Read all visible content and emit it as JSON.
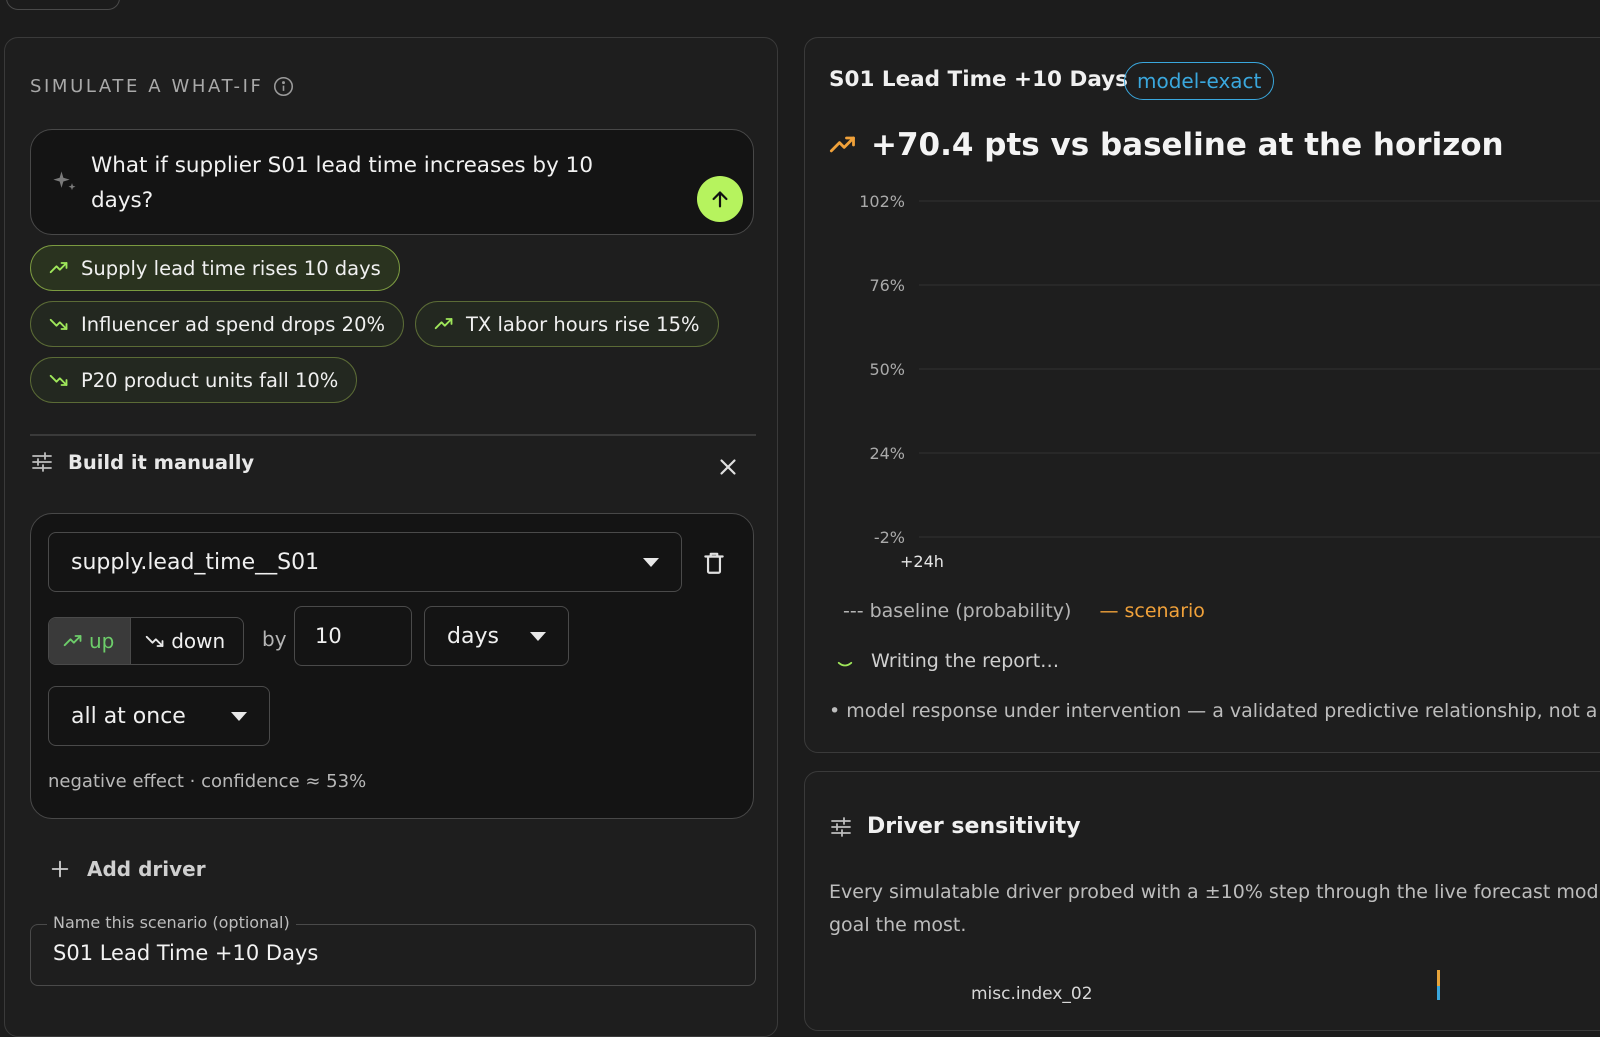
{
  "simulate": {
    "header": "SIMULATE A WHAT-IF",
    "prompt": "What if supplier S01 lead time increases by 10 days?",
    "suggestions": [
      {
        "label": "Supply lead time rises 10 days",
        "trend": "up",
        "active": true
      },
      {
        "label": "Influencer ad spend drops 20%",
        "trend": "down",
        "active": false
      },
      {
        "label": "TX labor hours rise 15%",
        "trend": "up",
        "active": false
      },
      {
        "label": "P20 product units fall 10%",
        "trend": "down",
        "active": false
      }
    ]
  },
  "manual": {
    "title": "Build it manually",
    "driver": "supply.lead_time__S01",
    "direction_up": "up",
    "direction_down": "down",
    "selected_direction": "up",
    "by_label": "by",
    "amount": "10",
    "unit": "days",
    "timing": "all at once",
    "effect": "negative effect · confidence ≈ 53%",
    "add_driver": "Add driver",
    "name_label": "Name this scenario (optional)",
    "name_value": "S01 Lead Time +10 Days"
  },
  "scenario": {
    "title": "S01 Lead Time +10 Days",
    "badge": "model-exact",
    "headline": "+70.4 pts vs baseline at the horizon",
    "legend_baseline": "--- baseline (probability)",
    "legend_scenario": "— scenario",
    "writing": "Writing the report…",
    "response": "• model response under intervention — a validated predictive relationship, not a"
  },
  "chart_data": {
    "type": "line",
    "y_ticks": [
      "102%",
      "76%",
      "50%",
      "24%",
      "-2%"
    ],
    "ylim": [
      -2,
      102
    ],
    "x_ticks": [
      "+24h"
    ],
    "series": [
      {
        "name": "baseline (probability)",
        "values": []
      },
      {
        "name": "scenario",
        "values": []
      }
    ]
  },
  "sensitivity": {
    "title": "Driver sensitivity",
    "description": "Every simulatable driver probed with a ±10% step through the live forecast mod",
    "description_line2": "goal the most.",
    "rows": [
      {
        "label": "misc.index_02"
      }
    ]
  },
  "colors": {
    "accent_green": "#b6f35e",
    "badge_blue": "#3aa7dd",
    "scenario_orange": "#f0a13a",
    "up_green": "#6dcd6a"
  }
}
